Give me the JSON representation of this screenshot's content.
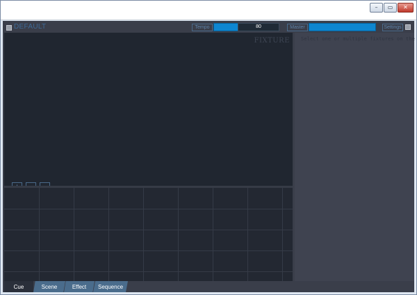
{
  "window": {
    "caption_buttons": [
      {
        "name": "minimize",
        "glyph": "–"
      },
      {
        "name": "maximize",
        "glyph": "▭"
      },
      {
        "name": "close",
        "glyph": "✕"
      }
    ]
  },
  "toolbar": {
    "preset_name": "DEFAULT",
    "tempo_label": "Tempo",
    "tempo_value": "80",
    "master_label": "Master",
    "master_level": 1.0,
    "settings_label": "Settings"
  },
  "stage": {
    "watermark": "FIXTURE",
    "buttons": [
      {
        "name": "add",
        "glyph": "+"
      },
      {
        "name": "remove",
        "glyph": "–"
      },
      {
        "name": "more",
        "glyph": "..."
      }
    ]
  },
  "side_panel": {
    "hint": "Select one or multiple fixtures on the left"
  },
  "tabs": [
    {
      "label": "Cue",
      "active": true
    },
    {
      "label": "Scene",
      "active": false
    },
    {
      "label": "Effect",
      "active": false
    },
    {
      "label": "Sequence",
      "active": false
    }
  ],
  "colors": {
    "accent": "#0e86d0",
    "background": "#3a3e4a",
    "stage": "#202630",
    "tab_inactive": "#4a6c8c"
  }
}
